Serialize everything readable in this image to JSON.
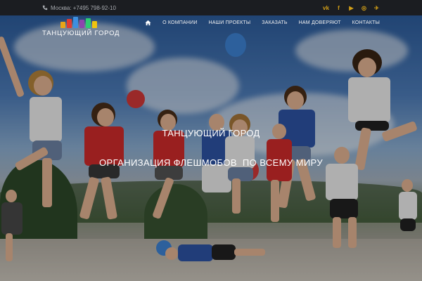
{
  "topbar": {
    "phone": "Москва: +7495 798-92-10",
    "socials": [
      {
        "icon": "vk-icon",
        "glyph": "vk"
      },
      {
        "icon": "facebook-icon",
        "glyph": "f"
      },
      {
        "icon": "youtube-icon",
        "glyph": "▶"
      },
      {
        "icon": "instagram-icon",
        "glyph": "◎"
      },
      {
        "icon": "twitter-icon",
        "glyph": "✈"
      }
    ],
    "accent_color": "#d4a017"
  },
  "header": {
    "logo_text": "ТАНЦУЮЩИЙ ГОРОД",
    "logo_bar_colors": [
      "#e8a517",
      "#e03c31",
      "#3d8fe0",
      "#8e44ad",
      "#2ecc71",
      "#f1c40f"
    ],
    "nav": {
      "home_icon": "home-icon",
      "items": [
        "О КОМПАНИИ",
        "НАШИ ПРОЕКТЫ",
        "ЗАКАЗАТЬ",
        "НАМ ДОВЕРЯЮТ",
        "КОНТАКТЫ"
      ]
    }
  },
  "hero": {
    "title": "ТАНЦУЮЩИЙ ГОРОД",
    "subtitle": "ОРГАНИЗАЦИЯ ФЛЕШМОБОВ  ПО ВСЕМУ МИРУ"
  }
}
